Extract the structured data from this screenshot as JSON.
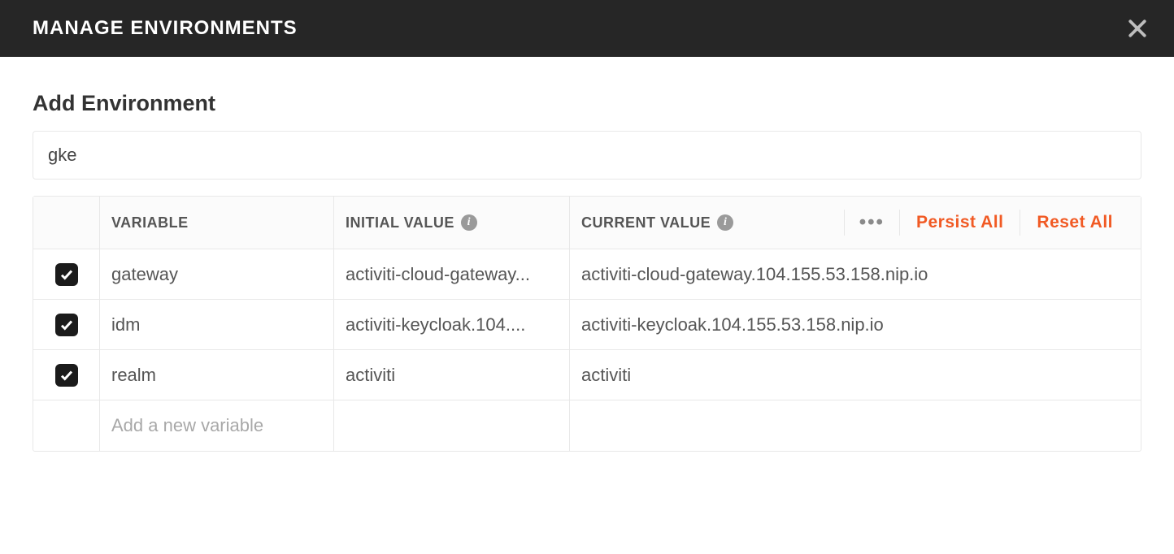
{
  "header": {
    "title": "MANAGE ENVIRONMENTS"
  },
  "section": {
    "heading": "Add Environment",
    "env_name": "gke"
  },
  "table": {
    "headers": {
      "variable": "VARIABLE",
      "initial": "INITIAL VALUE",
      "current": "CURRENT VALUE"
    },
    "actions": {
      "persist": "Persist All",
      "reset": "Reset All"
    },
    "placeholder": "Add a new variable",
    "rows": [
      {
        "checked": true,
        "variable": "gateway",
        "initial": "activiti-cloud-gateway...",
        "current": "activiti-cloud-gateway.104.155.53.158.nip.io"
      },
      {
        "checked": true,
        "variable": "idm",
        "initial": "activiti-keycloak.104....",
        "current": "activiti-keycloak.104.155.53.158.nip.io"
      },
      {
        "checked": true,
        "variable": "realm",
        "initial": "activiti",
        "current": "activiti"
      }
    ]
  }
}
